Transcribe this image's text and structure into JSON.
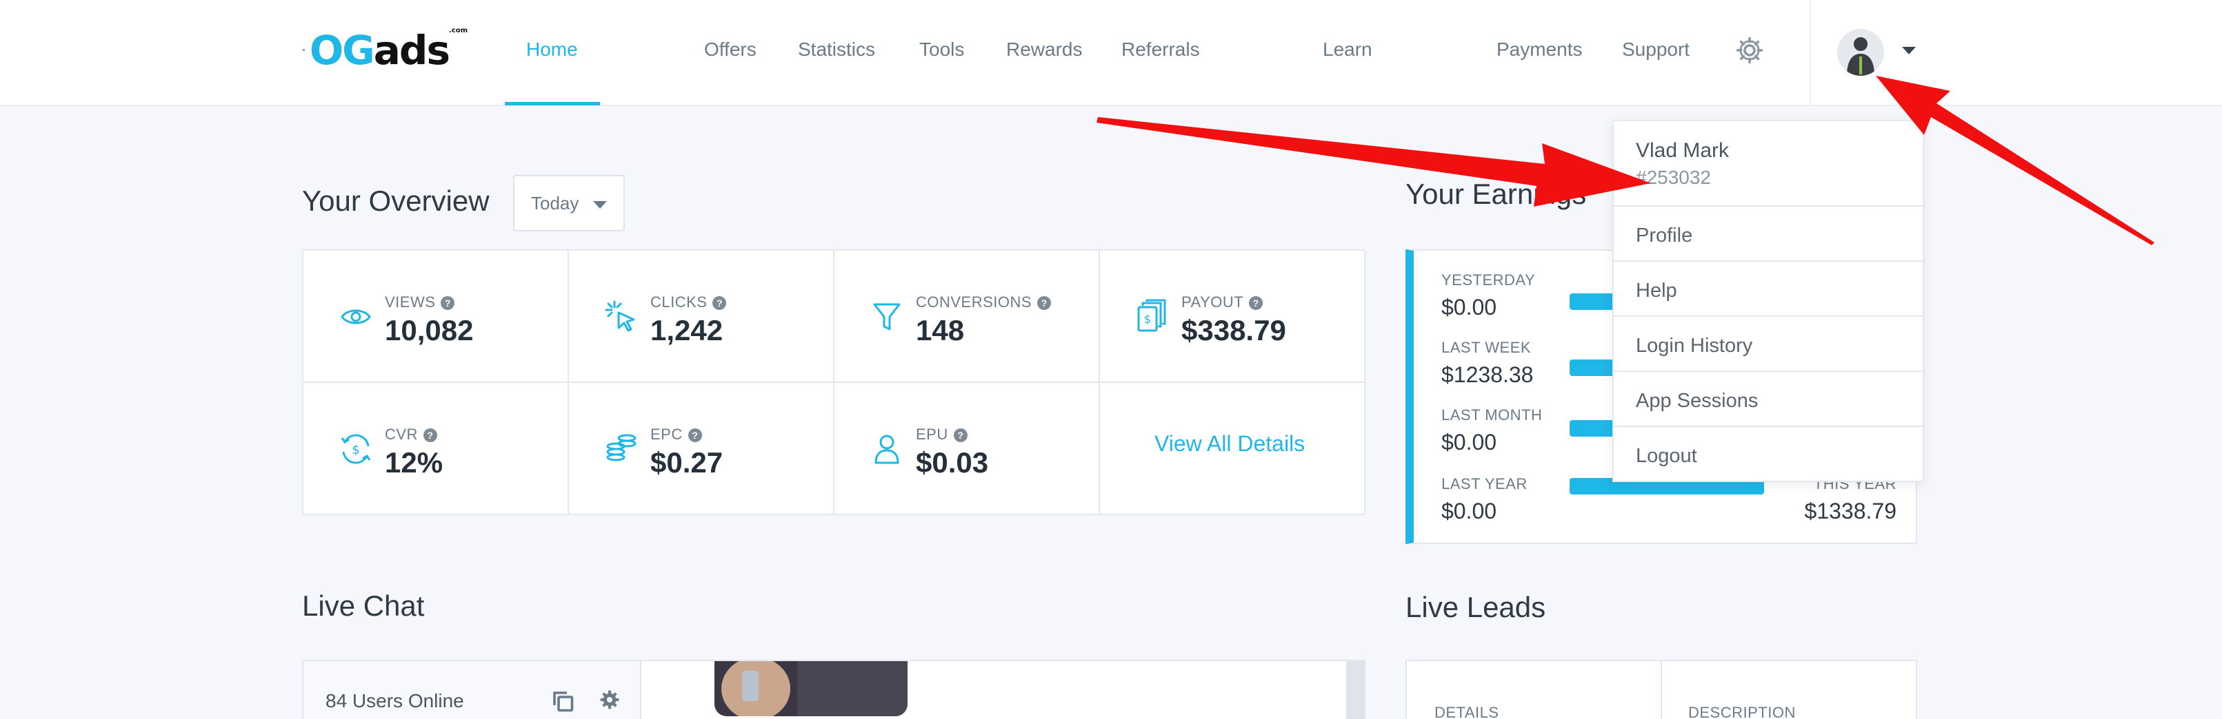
{
  "brand": {
    "logo_text_a": "OG",
    "logo_text_b": "ads",
    "logo_suffix": ".com"
  },
  "nav": {
    "home": "Home",
    "offers": "Offers",
    "statistics": "Statistics",
    "tools": "Tools",
    "rewards": "Rewards",
    "referrals": "Referrals",
    "learn": "Learn",
    "payments": "Payments",
    "support": "Support"
  },
  "overview": {
    "title": "Your Overview",
    "range": "Today",
    "stats": {
      "views": {
        "label": "VIEWS",
        "value": "10,082"
      },
      "clicks": {
        "label": "CLICKS",
        "value": "1,242"
      },
      "conversions": {
        "label": "CONVERSIONS",
        "value": "148"
      },
      "payout": {
        "label": "PAYOUT",
        "value": "$338.79"
      },
      "cvr": {
        "label": "CVR",
        "value": "12%"
      },
      "epc": {
        "label": "EPC",
        "value": "$0.27"
      },
      "epu": {
        "label": "EPU",
        "value": "$0.03"
      }
    },
    "view_all": "View All Details",
    "help_glyph": "?"
  },
  "earnings": {
    "title": "Your Earnings",
    "rows": [
      {
        "label": "YESTERDAY",
        "value": "$0.00"
      },
      {
        "label": "LAST WEEK",
        "value": "$1238.38"
      },
      {
        "label": "LAST MONTH",
        "value": "$0.00"
      },
      {
        "label": "LAST YEAR",
        "value": "$0.00"
      }
    ],
    "this_year": {
      "label": "THIS YEAR",
      "value": "$1338.79"
    }
  },
  "user_menu": {
    "name": "Vlad Mark",
    "id": "#253032",
    "items": [
      "Profile",
      "Help",
      "Login History",
      "App Sessions",
      "Logout"
    ]
  },
  "chat": {
    "title": "Live Chat",
    "online": "84 Users Online"
  },
  "leads": {
    "title": "Live Leads",
    "col_details": "DETAILS",
    "col_description": "DESCRIPTION"
  },
  "colors": {
    "accent": "#1fb6e8",
    "arrow": "#f01010"
  }
}
